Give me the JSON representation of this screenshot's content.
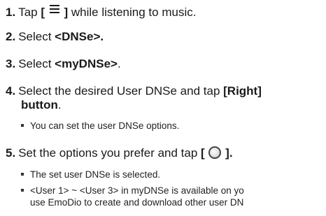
{
  "steps": [
    {
      "num": "1.",
      "pre": "Tap ",
      "bracket_open": "[",
      "bracket_close": "]",
      "post": " while listening to music.",
      "icon": "menu-icon"
    },
    {
      "num": "2.",
      "pre": "Select ",
      "bold": "<DNSe>."
    },
    {
      "num": "3.",
      "pre": "Select ",
      "bold": "<myDNSe>",
      "post": "."
    },
    {
      "num": "4.",
      "pre": "Select the desired User DNSe and tap ",
      "bold": "[Right]",
      "line2_bold": "button",
      "line2_post": "."
    },
    {
      "num": "5.",
      "pre": "Set the options you prefer and tap ",
      "bracket_open": "[",
      "bracket_close": "].",
      "icon": "ok-circle-icon"
    }
  ],
  "notes": {
    "step4": [
      "You can set the user DNSe options."
    ],
    "step5": [
      "The set user DNSe is selected.",
      "<User 1> ~ <User 3> in myDNSe is available on yo",
      "use EmoDio to create and download other user DN"
    ]
  }
}
